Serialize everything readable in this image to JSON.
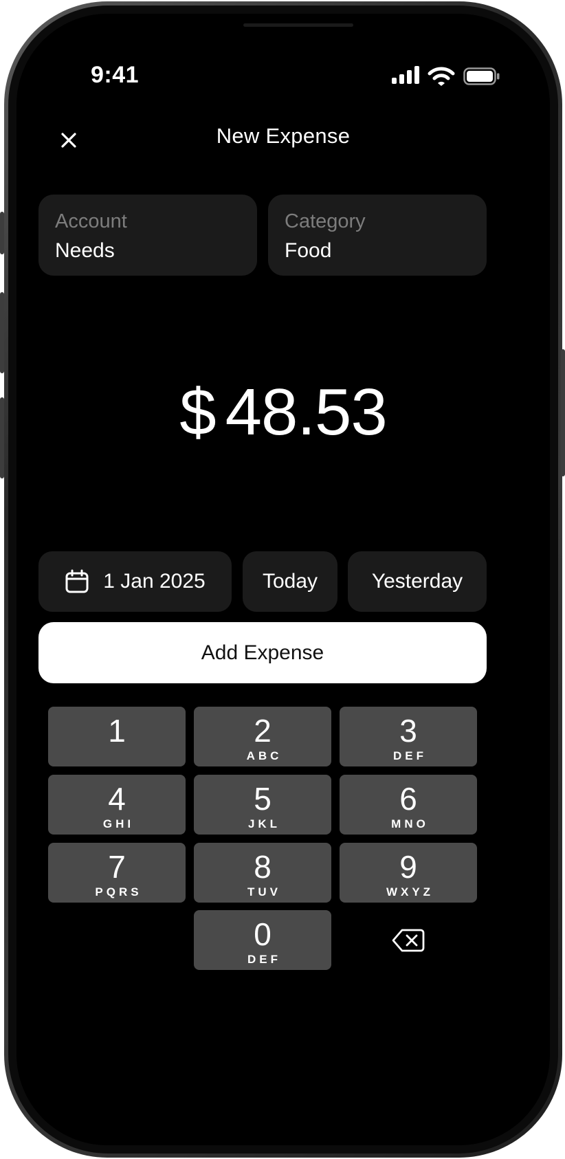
{
  "status_bar": {
    "time": "9:41"
  },
  "header": {
    "title": "New Expense"
  },
  "account": {
    "label": "Account",
    "value": "Needs"
  },
  "category": {
    "label": "Category",
    "value": "Food"
  },
  "amount": {
    "currency": "$",
    "value": "48.53"
  },
  "date_row": {
    "date": "1 Jan 2025",
    "today": "Today",
    "yesterday": "Yesterday"
  },
  "add_button": {
    "label": "Add Expense"
  },
  "keypad": {
    "keys": [
      {
        "num": "1",
        "letters": ""
      },
      {
        "num": "2",
        "letters": "ABC"
      },
      {
        "num": "3",
        "letters": "DEF"
      },
      {
        "num": "4",
        "letters": "GHI"
      },
      {
        "num": "5",
        "letters": "JKL"
      },
      {
        "num": "6",
        "letters": "MNO"
      },
      {
        "num": "7",
        "letters": "PQRS"
      },
      {
        "num": "8",
        "letters": "TUV"
      },
      {
        "num": "9",
        "letters": "WXYZ"
      },
      {
        "num": "0",
        "letters": "DEF"
      }
    ]
  },
  "icons": {
    "close": "close-icon",
    "calendar": "calendar-icon",
    "backspace": "backspace-icon",
    "signal": "cellular-signal-icon",
    "wifi": "wifi-icon",
    "battery": "battery-icon"
  },
  "colors": {
    "screen_bg": "#000000",
    "card_bg": "#1b1b1b",
    "key_bg": "#4a4a4a",
    "primary_button_bg": "#ffffff",
    "muted_text": "#7d7d7d"
  }
}
